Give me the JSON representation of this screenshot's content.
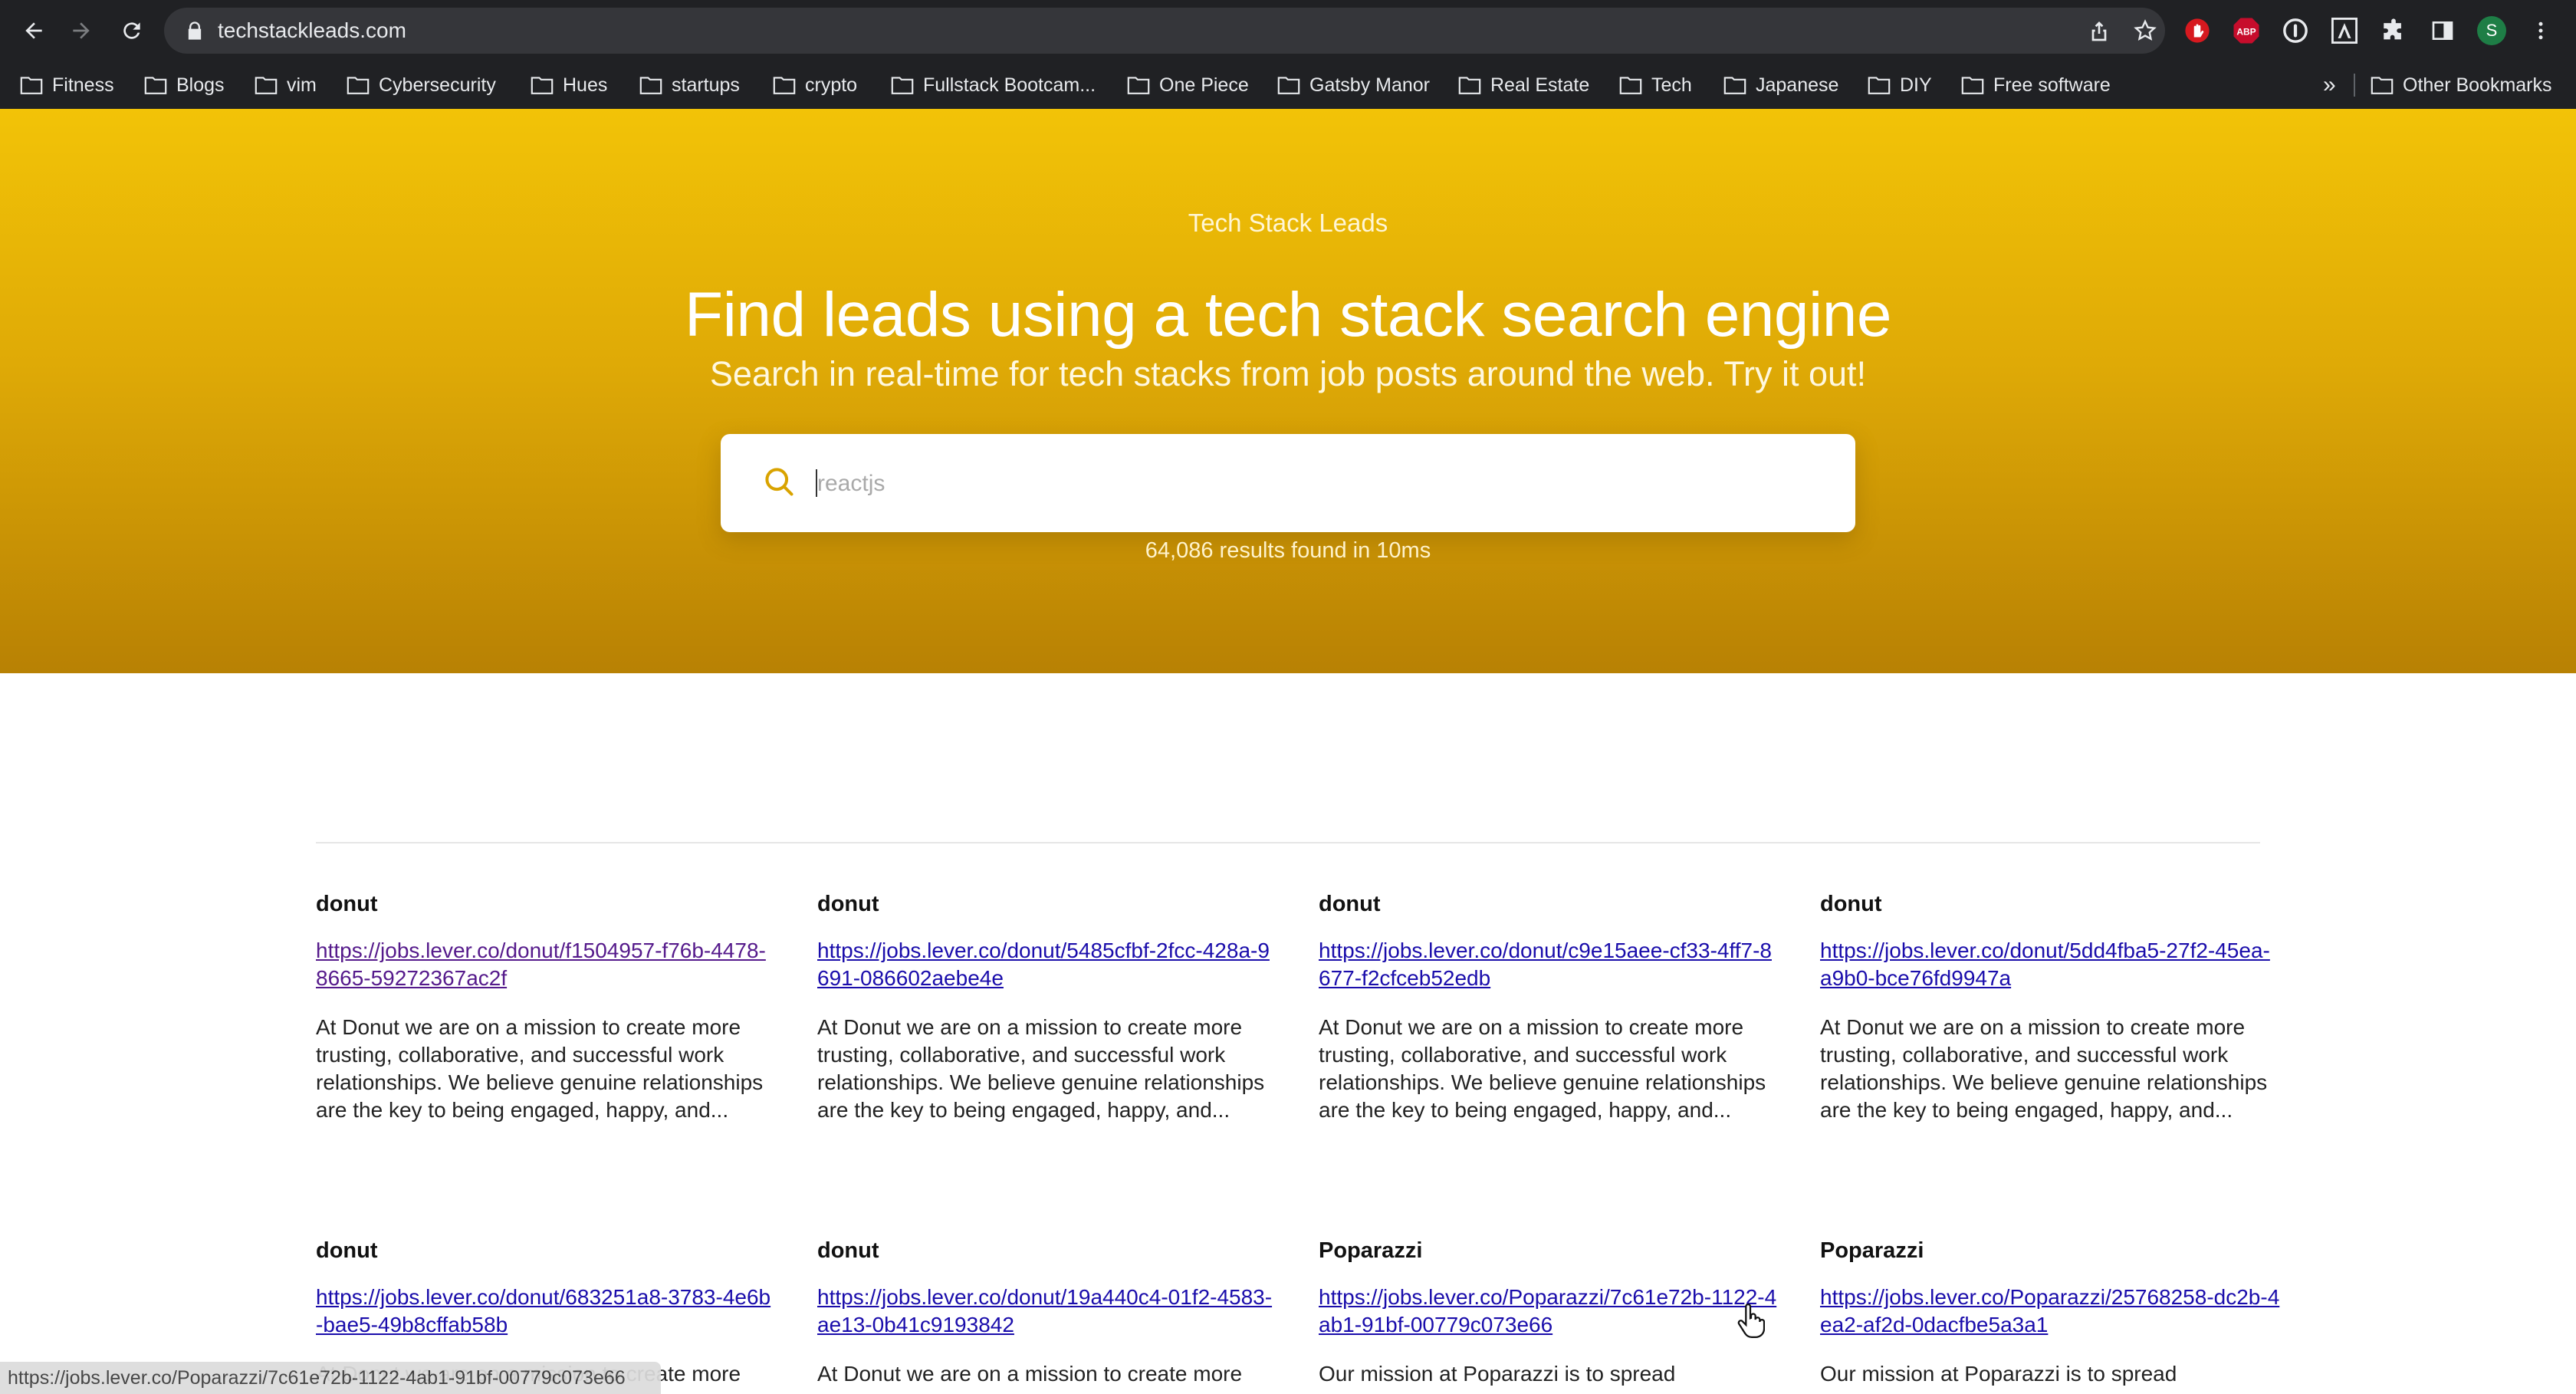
{
  "browser": {
    "url": "techstackleads.com",
    "bookmarks": [
      "Fitness",
      "Blogs",
      "vim",
      "Cybersecurity",
      "Hues",
      "startups",
      "crypto",
      "Fullstack Bootcam...",
      "One Piece",
      "Gatsby Manor",
      "Real Estate",
      "Tech",
      "Japanese",
      "DIY",
      "Free software"
    ],
    "bookmarks_overflow": "»",
    "other_bookmarks": "Other Bookmarks",
    "extensions": [
      "stop-extension",
      "ABP",
      "1password-extension",
      "arc-extension",
      "puzzle-extension",
      "sidebar-extension"
    ],
    "profile_initial": "S",
    "status_url": "https://jobs.lever.co/Poparazzi/7c61e72b-1122-4ab1-91bf-00779c073e66"
  },
  "hero": {
    "brand": "Tech Stack Leads",
    "headline": "Find leads using a tech stack search engine",
    "subline": "Search in real-time for tech stacks from job posts around the web. Try it out!",
    "search_placeholder": "reactjs",
    "results_count": "64,086 results found in 10ms"
  },
  "results": [
    {
      "company": "donut",
      "url": "https://jobs.lever.co/donut/f1504957-f76b-4478-8665-59272367ac2f",
      "description": "At Donut we are on a mission to create more trusting, collaborative, and successful work relationships. We believe genuine relationships are the key to being engaged, happy, and..."
    },
    {
      "company": "donut",
      "url": "https://jobs.lever.co/donut/5485cfbf-2fcc-428a-9691-086602aebe4e",
      "description": "At Donut we are on a mission to create more trusting, collaborative, and successful work relationships. We believe genuine relationships are the key to being engaged, happy, and..."
    },
    {
      "company": "donut",
      "url": "https://jobs.lever.co/donut/c9e15aee-cf33-4ff7-8677-f2cfceb52edb",
      "description": "At Donut we are on a mission to create more trusting, collaborative, and successful work relationships. We believe genuine relationships are the key to being engaged, happy, and..."
    },
    {
      "company": "donut",
      "url": "https://jobs.lever.co/donut/5dd4fba5-27f2-45ea-a9b0-bce76fd9947a",
      "description": "At Donut we are on a mission to create more trusting, collaborative, and successful work relationships. We believe genuine relationships are the key to being engaged, happy, and..."
    },
    {
      "company": "donut",
      "url": "https://jobs.lever.co/donut/683251a8-3783-4e6b-bae5-49b8cffab58b",
      "description": "At Donut we are on a mission to create more"
    },
    {
      "company": "donut",
      "url": "https://jobs.lever.co/donut/19a440c4-01f2-4583-ae13-0b41c9193842",
      "description": "At Donut we are on a mission to create more"
    },
    {
      "company": "Poparazzi",
      "url": "https://jobs.lever.co/Poparazzi/7c61e72b-1122-4ab1-91bf-00779c073e66",
      "description": "Our mission at Poparazzi is to spread"
    },
    {
      "company": "Poparazzi",
      "url": "https://jobs.lever.co/Poparazzi/25768258-dc2b-4ea2-af2d-0dacfbe5a3a1",
      "description": "Our mission at Poparazzi is to spread"
    }
  ],
  "colors": {
    "hero_top": "#f2c307",
    "hero_bottom": "#b88104",
    "search_icon": "#d9a300",
    "link": "#1a0dab",
    "visited_link": "#551a8b",
    "chrome_bg": "#202124"
  }
}
